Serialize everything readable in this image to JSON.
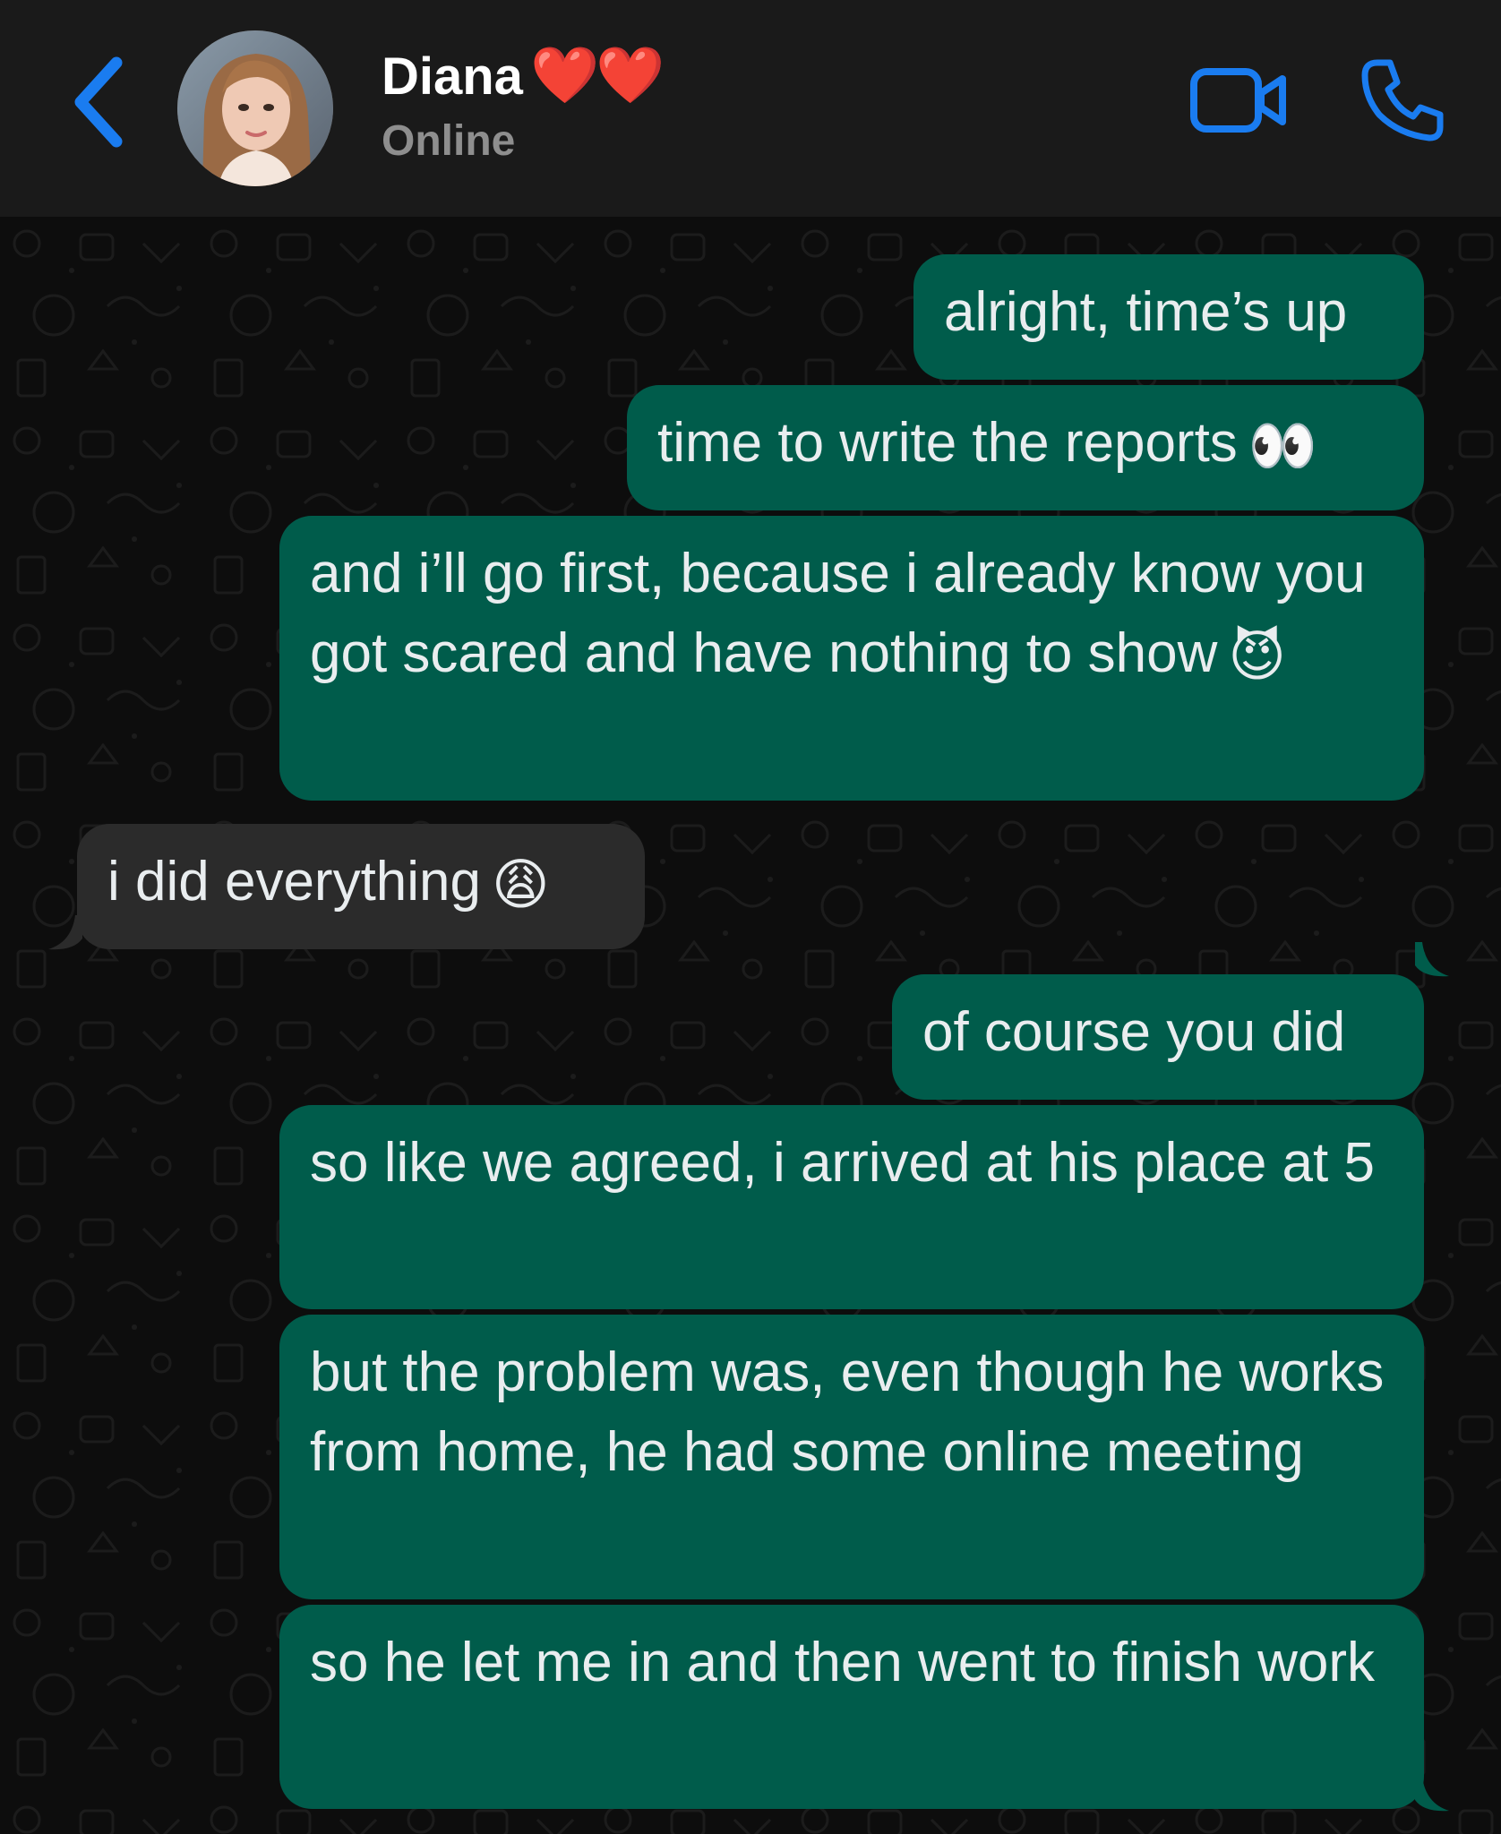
{
  "header": {
    "contact_name": "Diana",
    "name_emoji": "❤️❤️",
    "status": "Online",
    "accent_color": "#1a7cf0"
  },
  "messages": [
    {
      "direction": "outgoing",
      "text": "alright, time’s up",
      "emoji": ""
    },
    {
      "direction": "outgoing",
      "text": "time to write the reports",
      "emoji": "👀"
    },
    {
      "direction": "outgoing",
      "text": "and i’ll go first, because i already know you got scared and have nothing to show",
      "emoji": "😈"
    },
    {
      "direction": "incoming",
      "text": "i did everything",
      "emoji": "😩"
    },
    {
      "direction": "outgoing",
      "text": "of course you did",
      "emoji": ""
    },
    {
      "direction": "outgoing",
      "text": "so like we agreed, i arrived at his place at 5",
      "emoji": ""
    },
    {
      "direction": "outgoing",
      "text": "but the problem was, even though he works from home, he had some online meeting",
      "emoji": ""
    },
    {
      "direction": "outgoing",
      "text": "so he let me in and then went to finish work",
      "emoji": ""
    }
  ],
  "colors": {
    "outgoing_bubble": "#005c4b",
    "incoming_bubble": "#2b2b2b",
    "header_bg": "#1a1a1a",
    "text": "#e9edef"
  },
  "icons": {
    "back": "chevron-left-icon",
    "video": "video-camera-icon",
    "call": "phone-icon"
  }
}
